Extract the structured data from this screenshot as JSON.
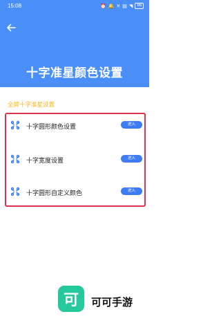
{
  "status_bar": {
    "time": "15:08",
    "icons": [
      "alarm-icon",
      "bell-icon",
      "mute-icon",
      "sim-icon",
      "wifi-icon"
    ],
    "battery": "86"
  },
  "header": {
    "title": "十字准星颜色设置",
    "background_color": "#4a8ff7"
  },
  "section": {
    "title": "全屏十字准星设置",
    "title_color": "#f5b51a"
  },
  "rows": [
    {
      "label": "十字圆形颜色设置",
      "button": "进入"
    },
    {
      "label": "十字宽度设置",
      "button": "进入"
    },
    {
      "label": "十字圆形自定义颜色",
      "button": "进入"
    }
  ],
  "watermark": {
    "logo_char": "可",
    "text": "可可手游"
  }
}
